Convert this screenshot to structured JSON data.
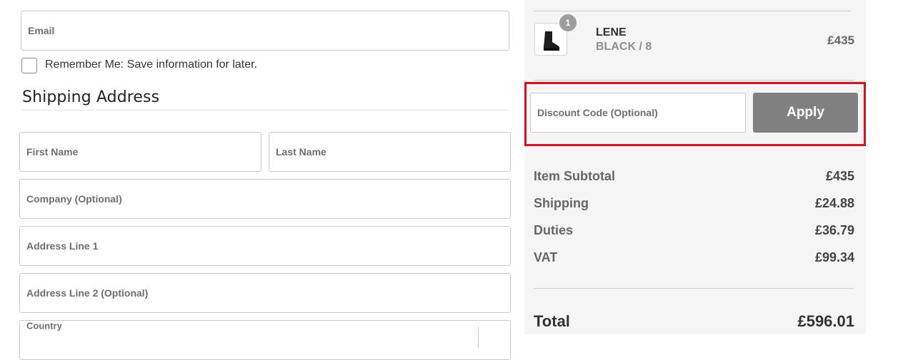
{
  "form": {
    "email_placeholder": "Email",
    "remember_label": "Remember Me: Save information for later.",
    "shipping_title": "Shipping Address",
    "first_name_placeholder": "First Name",
    "last_name_placeholder": "Last Name",
    "company_placeholder": "Company (Optional)",
    "address1_placeholder": "Address Line 1",
    "address2_placeholder": "Address Line 2 (Optional)",
    "country_label": "Country"
  },
  "summary": {
    "item": {
      "name": "LENE",
      "variant": "BLACK / 8",
      "price": "£435",
      "quantity": "1",
      "thumbnail_icon": "boot-icon"
    },
    "discount": {
      "placeholder": "Discount Code (Optional)",
      "apply_label": "Apply"
    },
    "lines": [
      {
        "label": "Item Subtotal",
        "value": "£435"
      },
      {
        "label": "Shipping",
        "value": "£24.88"
      },
      {
        "label": "Duties",
        "value": "£36.79"
      },
      {
        "label": "VAT",
        "value": "£99.34"
      }
    ],
    "total": {
      "label": "Total",
      "value": "£596.01"
    }
  },
  "colors": {
    "highlight": "#e0101b",
    "apply_button": "#808080",
    "panel_bg": "#f5f5f5"
  }
}
